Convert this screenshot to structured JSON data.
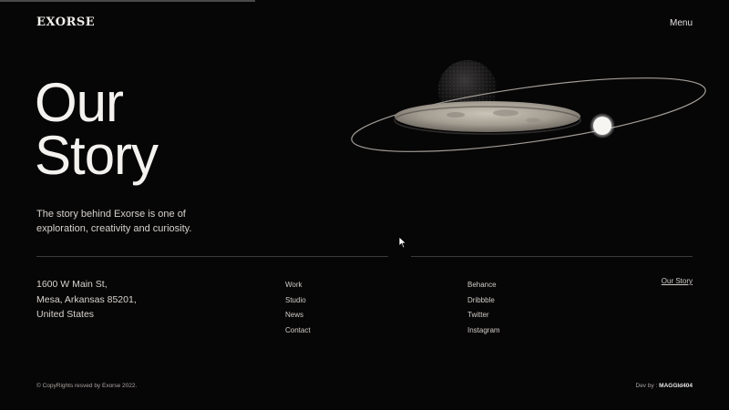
{
  "header": {
    "logo": "EXORSE",
    "menu_label": "Menu"
  },
  "hero": {
    "title_line1": "Our",
    "title_line2": "Story",
    "tagline": "The story behind Exorse is one of exploration, creativity and curiosity."
  },
  "address": {
    "line1": "1600 W Main St,",
    "line2": "Mesa, Arkansas 85201,",
    "line3": "United States"
  },
  "nav": {
    "pages": [
      "Work",
      "Studio",
      "News",
      "Contact"
    ],
    "social": [
      "Behance",
      "Dribbble",
      "Twitter",
      "Instagram"
    ]
  },
  "current_page_link": "Our Story",
  "footer": {
    "copyright": "© CopyRights resved by Exorse 2022.",
    "dev_prefix": "Dev by : ",
    "dev_name": "MAGGId404"
  },
  "colors": {
    "background": "#070607",
    "text": "#e8e6e3",
    "divider": "#3a3a3a"
  }
}
